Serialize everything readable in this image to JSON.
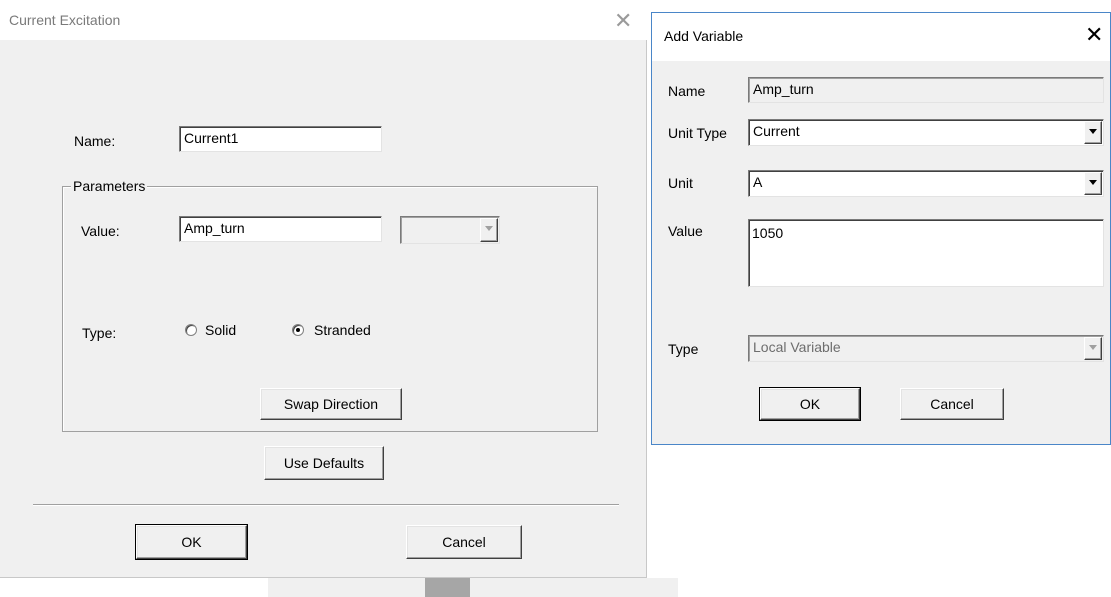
{
  "current_excitation": {
    "title": "Current Excitation",
    "name_label": "Name:",
    "name_value": "Current1",
    "parameters_group": "Parameters",
    "value_label": "Value:",
    "value_value": "Amp_turn",
    "unit_value": "",
    "type_label": "Type:",
    "type_options": [
      {
        "label": "Solid",
        "checked": false
      },
      {
        "label": "Stranded",
        "checked": true
      }
    ],
    "swap_direction_label": "Swap Direction",
    "use_defaults_label": "Use Defaults",
    "ok_label": "OK",
    "cancel_label": "Cancel"
  },
  "add_variable": {
    "title": "Add Variable",
    "name_label": "Name",
    "name_value": "Amp_turn",
    "unit_type_label": "Unit Type",
    "unit_type_value": "Current",
    "unit_label": "Unit",
    "unit_value": "A",
    "value_label": "Value",
    "value_value": "1050",
    "type_label": "Type",
    "type_value": "Local Variable",
    "ok_label": "OK",
    "cancel_label": "Cancel"
  },
  "icons": {
    "close": "✕"
  }
}
